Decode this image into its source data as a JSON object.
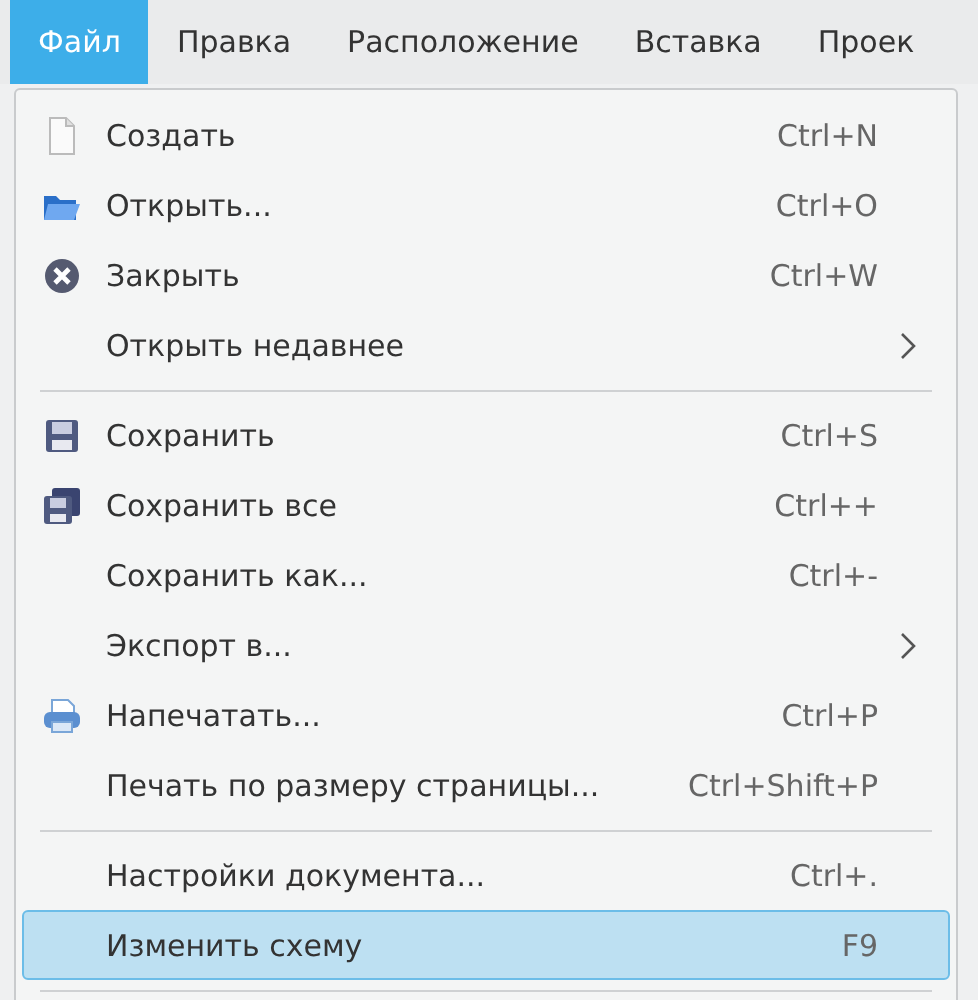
{
  "menubar": [
    {
      "label": "Файл",
      "selected": true
    },
    {
      "label": "Правка",
      "selected": false
    },
    {
      "label": "Расположение",
      "selected": false
    },
    {
      "label": "Вставка",
      "selected": false
    },
    {
      "label": "Проек",
      "selected": false
    }
  ],
  "menu": [
    {
      "kind": "item",
      "label": "Создать",
      "shortcut": "Ctrl+N",
      "submenu": false,
      "selected": false
    },
    {
      "kind": "item",
      "label": "Открыть...",
      "shortcut": "Ctrl+O",
      "submenu": false,
      "selected": false
    },
    {
      "kind": "item",
      "label": "Закрыть",
      "shortcut": "Ctrl+W",
      "submenu": false,
      "selected": false
    },
    {
      "kind": "item",
      "label": "Открыть недавнее",
      "submenu": true,
      "selected": false
    },
    {
      "kind": "separator"
    },
    {
      "kind": "item",
      "label": "Сохранить",
      "shortcut": "Ctrl+S",
      "submenu": false,
      "selected": false
    },
    {
      "kind": "item",
      "label": "Сохранить все",
      "shortcut": "Ctrl++",
      "submenu": false,
      "selected": false
    },
    {
      "kind": "item",
      "label": "Сохранить как...",
      "shortcut": "Ctrl+-",
      "submenu": false,
      "selected": false
    },
    {
      "kind": "item",
      "label": "Экспорт в...",
      "submenu": true,
      "selected": false
    },
    {
      "kind": "item",
      "label": "Напечатать...",
      "shortcut": "Ctrl+P",
      "submenu": false,
      "selected": false
    },
    {
      "kind": "item",
      "label": "Печать по размеру страницы...",
      "shortcut": "Ctrl+Shift+P",
      "submenu": false,
      "selected": false
    },
    {
      "kind": "separator"
    },
    {
      "kind": "item",
      "label": "Настройки документа...",
      "shortcut": "Ctrl+.",
      "submenu": false,
      "selected": false
    },
    {
      "kind": "item",
      "label": "Изменить схему",
      "shortcut": "F9",
      "submenu": false,
      "selected": true
    },
    {
      "kind": "separator"
    }
  ]
}
